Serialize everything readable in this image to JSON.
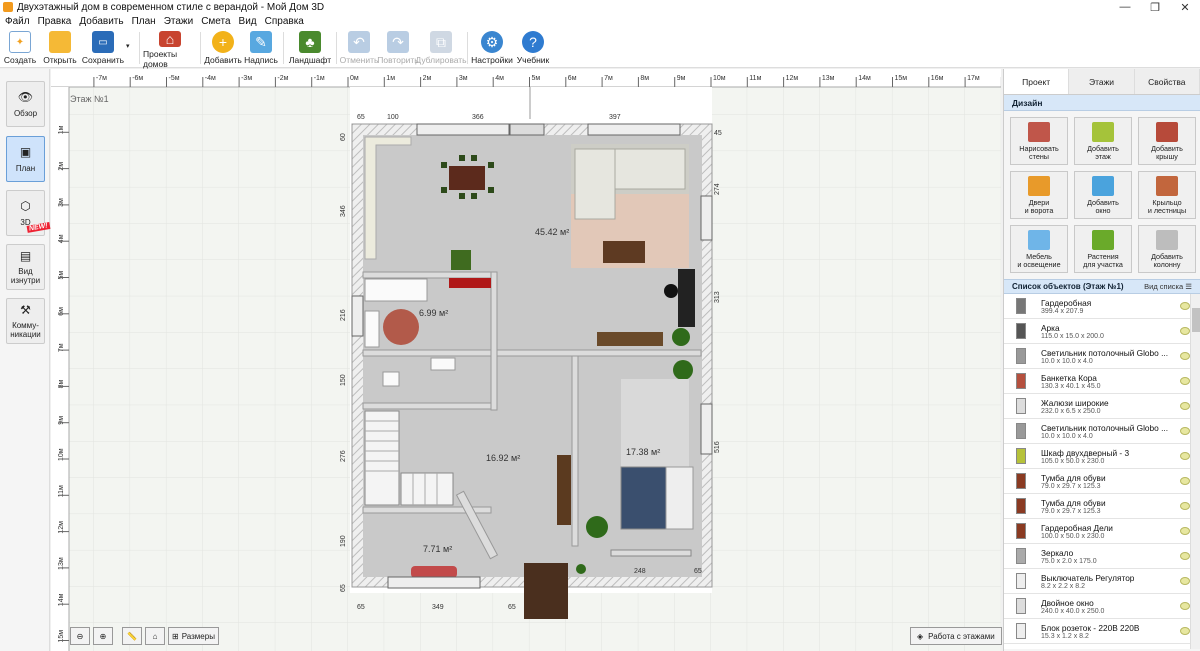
{
  "window": {
    "title": "Двухэтажный дом в современном стиле с верандой - Мой Дом 3D"
  },
  "menu": [
    "Файл",
    "Правка",
    "Добавить",
    "План",
    "Этажи",
    "Смета",
    "Вид",
    "Справка"
  ],
  "toolbar": {
    "create": "Создать",
    "open": "Открыть",
    "save": "Сохранить",
    "projects": "Проекты домов",
    "add": "Добавить",
    "label": "Надпись",
    "landscape": "Ландшафт",
    "undo": "Отменить",
    "redo": "Повторить",
    "duplicate": "Дублировать",
    "settings": "Настройки",
    "tutorial": "Учебник"
  },
  "leftbar": {
    "overview": "Обзор",
    "plan": "План",
    "view3d": "3D",
    "inside_1": "Вид",
    "inside_2": "изнутри",
    "comm_1": "Комму-",
    "comm_2": "никации",
    "new_badge": "NEW!"
  },
  "canvas": {
    "floor_label": "Этаж №1",
    "ruler_top": [
      "-7м",
      "-6м",
      "-5м",
      "-4м",
      "-3м",
      "-2м",
      "-1м",
      "0м",
      "1м",
      "2м",
      "3м",
      "4м",
      "5м",
      "6м",
      "7м",
      "8м",
      "9м",
      "10м",
      "11м",
      "12м",
      "13м",
      "14м",
      "15м",
      "16м",
      "17м",
      "18м"
    ],
    "ruler_left": [
      "1м",
      "2м",
      "3м",
      "4м",
      "5м",
      "6м",
      "7м",
      "8м",
      "9м",
      "10м",
      "11м",
      "12м",
      "13м",
      "14м",
      "15м"
    ],
    "dims_top": [
      "65",
      "100",
      "366",
      "397",
      "45"
    ],
    "dims_left": [
      "60",
      "346",
      "216",
      "150",
      "276",
      "190",
      "65"
    ],
    "dims_right": [
      "274",
      "313",
      "516"
    ],
    "dims_bottom": [
      "65",
      "349",
      "65",
      "248",
      "65"
    ],
    "room_areas": [
      "45.42 м²",
      "6.99 м²",
      "16.92 м²",
      "17.38 м²",
      "7.71 м²"
    ]
  },
  "bottom": {
    "sizes": "Размеры",
    "floors": "Работа с этажами"
  },
  "panel": {
    "tabs": [
      "Проект",
      "Этажи",
      "Свойства"
    ],
    "design_header": "Дизайн",
    "design_buttons": [
      {
        "l1": "Нарисовать",
        "l2": "стены"
      },
      {
        "l1": "Добавить",
        "l2": "этаж"
      },
      {
        "l1": "Добавить",
        "l2": "крышу"
      },
      {
        "l1": "Двери",
        "l2": "и ворота"
      },
      {
        "l1": "Добавить",
        "l2": "окно"
      },
      {
        "l1": "Крыльцо",
        "l2": "и лестницы"
      },
      {
        "l1": "Мебель",
        "l2": "и освещение"
      },
      {
        "l1": "Растения",
        "l2": "для участка"
      },
      {
        "l1": "Добавить",
        "l2": "колонну"
      }
    ],
    "list_header": "Список объектов (Этаж №1)",
    "list_view": "Вид списка",
    "objects": [
      {
        "name": "Гардеробная",
        "dims": "399.4 x 207.9"
      },
      {
        "name": "Арка",
        "dims": "115.0 x 15.0 x 200.0"
      },
      {
        "name": "Светильник потолочный Globo ...",
        "dims": "10.0 x 10.0 x 4.0"
      },
      {
        "name": "Банкетка Кора",
        "dims": "130.3 x 40.1 x 45.0"
      },
      {
        "name": "Жалюзи широкие",
        "dims": "232.0 x 6.5 x 250.0"
      },
      {
        "name": "Светильник потолочный Globo ...",
        "dims": "10.0 x 10.0 x 4.0"
      },
      {
        "name": "Шкаф двухдверный - 3",
        "dims": "105.0 x 50.0 x 230.0"
      },
      {
        "name": "Тумба для обуви",
        "dims": "79.0 x 29.7 x 125.3"
      },
      {
        "name": "Тумба для обуви",
        "dims": "79.0 x 29.7 x 125.3"
      },
      {
        "name": "Гардеробная Дели",
        "dims": "100.0 x 50.0 x 230.0"
      },
      {
        "name": "Зеркало",
        "dims": "75.0 x 2.0 x 175.0"
      },
      {
        "name": "Выключатель Регулятор",
        "dims": "8.2 x 2.2 x 8.2"
      },
      {
        "name": "Двойное окно",
        "dims": "240.0 x 40.0 x 250.0"
      },
      {
        "name": "Блок розеток - 220В 220В",
        "dims": "15.3 x 1.2 x 8.2"
      }
    ]
  },
  "colors": {
    "accent": "#6a9fd8",
    "panel_header": "#d7e7f8",
    "floor": "#c9c9c9",
    "wall": "#dedede"
  }
}
